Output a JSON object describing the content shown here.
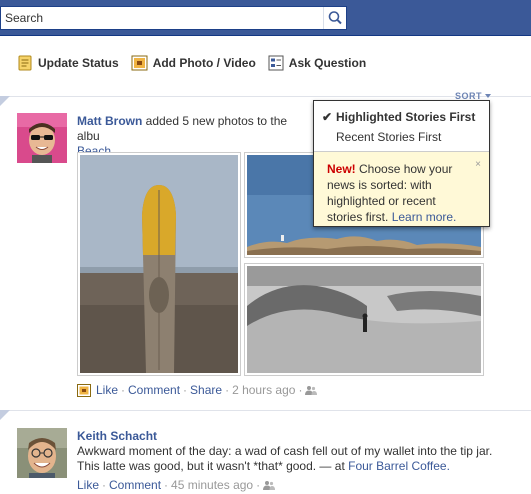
{
  "search": {
    "value": "Search",
    "placeholder": "Search"
  },
  "composer": {
    "update_status": "Update Status",
    "add_photo": "Add Photo / Video",
    "ask_question": "Ask Question"
  },
  "sort": {
    "label": "SORT",
    "options": [
      "Highlighted Stories First",
      "Recent Stories First"
    ],
    "selected": "Highlighted Stories First",
    "tip_new": "New!",
    "tip_text": " Choose how your news is sorted: with highlighted or recent stories first. ",
    "tip_link": "Learn more.",
    "close": "×"
  },
  "stories": [
    {
      "author": "Matt Brown",
      "text_before": " added 5 new photos to the albu",
      "text_line2": "Beach.",
      "actions": {
        "like": "Like",
        "comment": "Comment",
        "share": "Share",
        "time": "2 hours ago"
      }
    },
    {
      "author": "Keith Schacht",
      "text": "Awkward moment of the day: a wad of cash fell out of my wallet into the tip jar. This latte was good, but it wasn't *that* good. — at ",
      "place": "Four Barrel Coffee.",
      "actions": {
        "like": "Like",
        "comment": "Comment",
        "time": "45 minutes ago"
      }
    }
  ],
  "separator": "·",
  "colors": {
    "topbar": "#3b5998",
    "link": "#3b5998",
    "tip_bg": "#fff9d7",
    "new": "#cc0000"
  },
  "icons": [
    "search-icon",
    "status-icon",
    "photo-icon",
    "question-icon",
    "checkmark-icon",
    "friends-icon"
  ]
}
